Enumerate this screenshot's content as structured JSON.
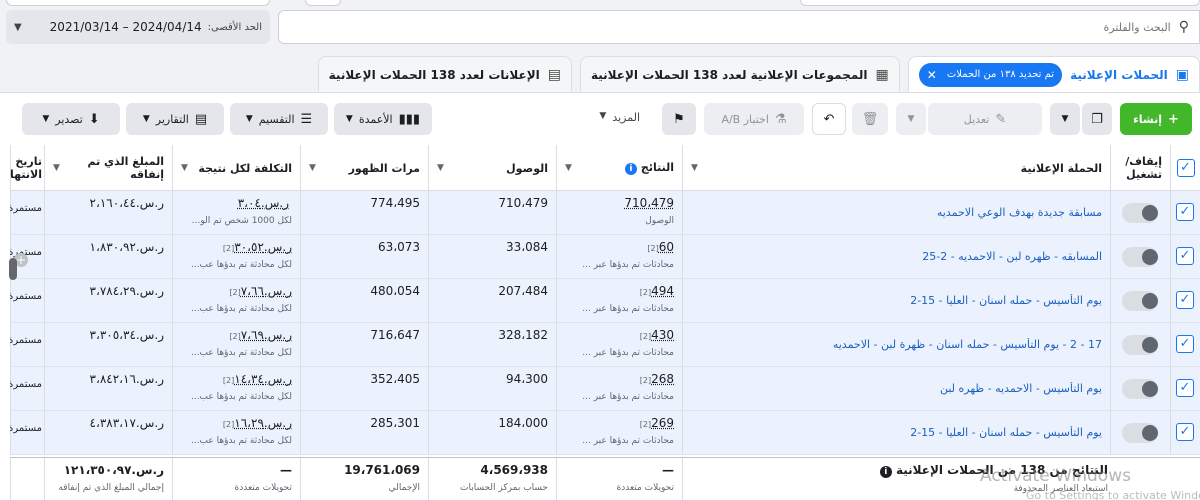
{
  "date_range": {
    "label": "الحد الأقصى:",
    "value": "2021/03/14 – 2024/04/14"
  },
  "search": {
    "placeholder": "البحث والفلترة"
  },
  "tabs": {
    "campaigns": {
      "label": "الحملات الإعلانية",
      "chip": "تم تحديد ١٣٨ من الحملات"
    },
    "adsets": {
      "label": "المجموعات الإعلانية لعدد 138 الحملات الإعلانية"
    },
    "ads": {
      "label": "الإعلانات لعدد 138 الحملات الإعلانية"
    }
  },
  "toolbar": {
    "create": "إنشاء",
    "edit": "تعديل",
    "ab_test": "اختبار A/B",
    "more": "المزيد",
    "columns": "الأعمدة",
    "breakdown": "التقسيم",
    "reports": "التقارير",
    "export": "تصدير"
  },
  "columns": {
    "toggle": "إيقاف/ تشغيل",
    "campaign": "الحملة الإعلانية",
    "results": "النتائج",
    "reach": "الوصول",
    "impressions": "مرات الظهور",
    "cost": "التكلفة لكل نتيجة",
    "spent": "المبلغ الذي تم إنفاقه",
    "end": "تاريخ الانتهاء"
  },
  "rows": [
    {
      "name": "مسابقة جديدة بهدف الوعي الاحمديه",
      "result": "710،479",
      "result_sub": "الوصول",
      "result_pre": "",
      "reach": "710،479",
      "impressions": "774،495",
      "cost": "ر.س.٣،٠٤",
      "cost_sub": "لكل 1000 شخص تم الو...",
      "cost_pre": "",
      "spent": "ر.س.٢،١٦٠،٤٤",
      "end": "مستمرة"
    },
    {
      "name": "المسابقه - ظهره لبن - الاحمديه - 2-25",
      "result": "60",
      "result_sub": "محادثات تم بدؤها عبر ...",
      "result_pre": "[2]",
      "reach": "33،084",
      "impressions": "63،073",
      "cost": "ر.س.٣٠،٥٢",
      "cost_sub": "لكل محادثة تم بدؤها عب...",
      "cost_pre": "[2]",
      "spent": "ر.س.١،٨٣٠،٩٢",
      "end": "مستمرة"
    },
    {
      "name": "يوم التأسيس - حمله اسنان - العليا - 15-2",
      "result": "494",
      "result_sub": "محادثات تم بدؤها عبر ...",
      "result_pre": "[2]",
      "reach": "207،484",
      "impressions": "480،054",
      "cost": "ر.س.٧،٦٦",
      "cost_sub": "لكل محادثة تم بدؤها عب...",
      "cost_pre": "[2]",
      "spent": "ر.س.٣،٧٨٤،٢٩",
      "end": "مستمرة"
    },
    {
      "name": "17 - 2 - يوم التأسيس - حمله اسنان - ظهرة لبن - الاحمديه",
      "result": "430",
      "result_sub": "محادثات تم بدؤها عبر ...",
      "result_pre": "[2]",
      "reach": "328،182",
      "impressions": "716،647",
      "cost": "ر.س.٧،٦٩",
      "cost_sub": "لكل محادثة تم بدؤها عب...",
      "cost_pre": "[2]",
      "spent": "ر.س.٣،٣٠٥،٣٤",
      "end": "مستمرة"
    },
    {
      "name": "يوم التأسيس - الاحمديه - ظهره لبن",
      "result": "268",
      "result_sub": "محادثات تم بدؤها عبر ...",
      "result_pre": "[2]",
      "reach": "94،300",
      "impressions": "352،405",
      "cost": "ر.س.١٤،٣٤",
      "cost_sub": "لكل محادثة تم بدؤها عب...",
      "cost_pre": "[2]",
      "spent": "ر.س.٣،٨٤٢،١٦",
      "end": "مستمرة"
    },
    {
      "name": "يوم التأسيس - حمله اسنان - العليا - 15-2",
      "result": "269",
      "result_sub": "محادثات تم بدؤها عبر ...",
      "result_pre": "[2]",
      "reach": "184،000",
      "impressions": "285،301",
      "cost": "ر.س.١٦،٢٩",
      "cost_sub": "لكل محادثة تم بدؤها عب...",
      "cost_pre": "[2]",
      "spent": "ر.س.٤،٣٨٣،١٧",
      "end": "مستمرة"
    }
  ],
  "totals": {
    "label": "النتائج من 138 من الحملات الإعلانية",
    "label_sub": "استبعاد العناصر المحذوفة",
    "results": "—",
    "results_sub": "تحويلات متعددة",
    "reach": "4،569،938",
    "reach_sub": "حساب بمركز الحسابات",
    "impressions": "19،761،069",
    "impressions_sub": "الإجمالي",
    "cost": "—",
    "cost_sub": "تحويلات متعددة",
    "spent": "ر.س.١٢١،٣٥٠،٩٧",
    "spent_sub": "إجمالي المبلغ الذي تم إنفاقه"
  },
  "watermark": {
    "title": "Activate Windows",
    "sub": "Go to Settings to activate Windows."
  }
}
